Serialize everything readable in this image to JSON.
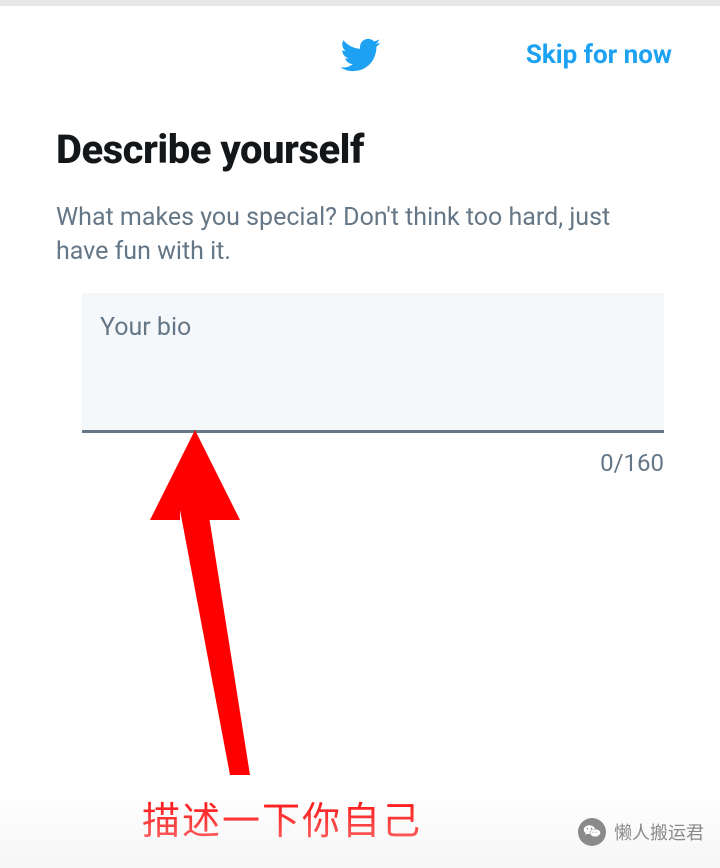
{
  "header": {
    "skip_label": "Skip for now"
  },
  "content": {
    "title": "Describe yourself",
    "subtitle": "What makes you special? Don't think too hard, just have fun with it.",
    "bio_placeholder": "Your bio",
    "bio_value": "",
    "char_counter": "0/160"
  },
  "annotation": {
    "text": "描述一下你自己"
  },
  "watermark": {
    "label": "懒人搬运君"
  },
  "colors": {
    "brand": "#1da1f2",
    "text_muted": "#657786",
    "annotation_red": "#ff0000"
  }
}
